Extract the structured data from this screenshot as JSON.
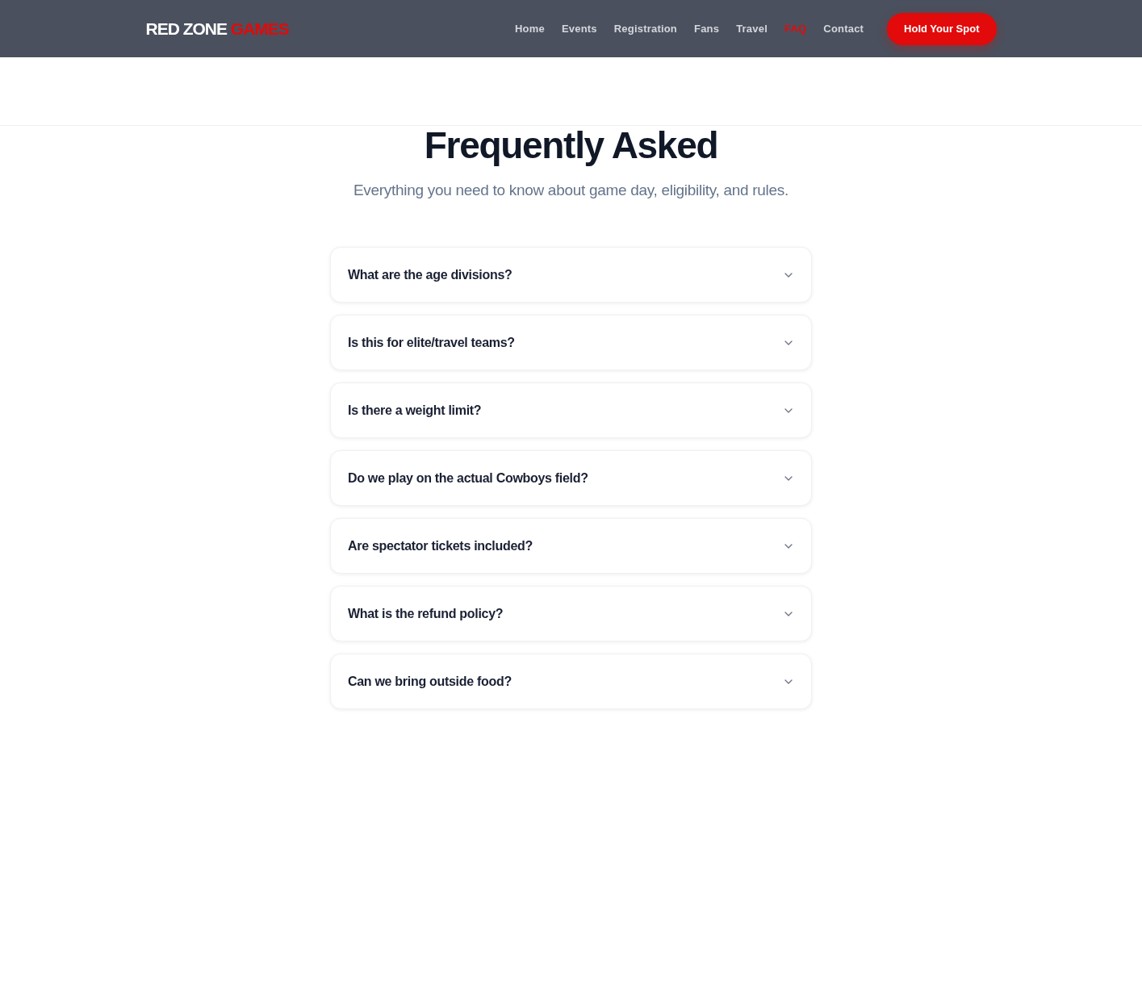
{
  "header": {
    "logo": {
      "text": "RED ZONE",
      "accent_text": "GAMES"
    },
    "nav": [
      {
        "label": "Home",
        "selected": false
      },
      {
        "label": "Events",
        "selected": false
      },
      {
        "label": "Registration",
        "selected": false
      },
      {
        "label": "Fans",
        "selected": false
      },
      {
        "label": "Travel",
        "selected": false
      },
      {
        "label": "FAQ",
        "selected": true
      },
      {
        "label": "Contact",
        "selected": false
      }
    ],
    "cta_button": "Hold Your Spot"
  },
  "faq": {
    "title": "Frequently Asked",
    "subtitle": "Everything you need to know about game day, eligibility, and rules.",
    "items": [
      {
        "question": "What are the age divisions?",
        "expanded": false
      },
      {
        "question": "Is this for elite/travel teams?",
        "expanded": false
      },
      {
        "question": "Is there a weight limit?",
        "expanded": false
      },
      {
        "question": "Do we play on the actual Cowboys field?",
        "expanded": false
      },
      {
        "question": "Are spectator tickets included?",
        "expanded": false
      },
      {
        "question": "What is the refund policy?",
        "expanded": false
      },
      {
        "question": "Can we bring outside food?",
        "expanded": false
      }
    ]
  }
}
